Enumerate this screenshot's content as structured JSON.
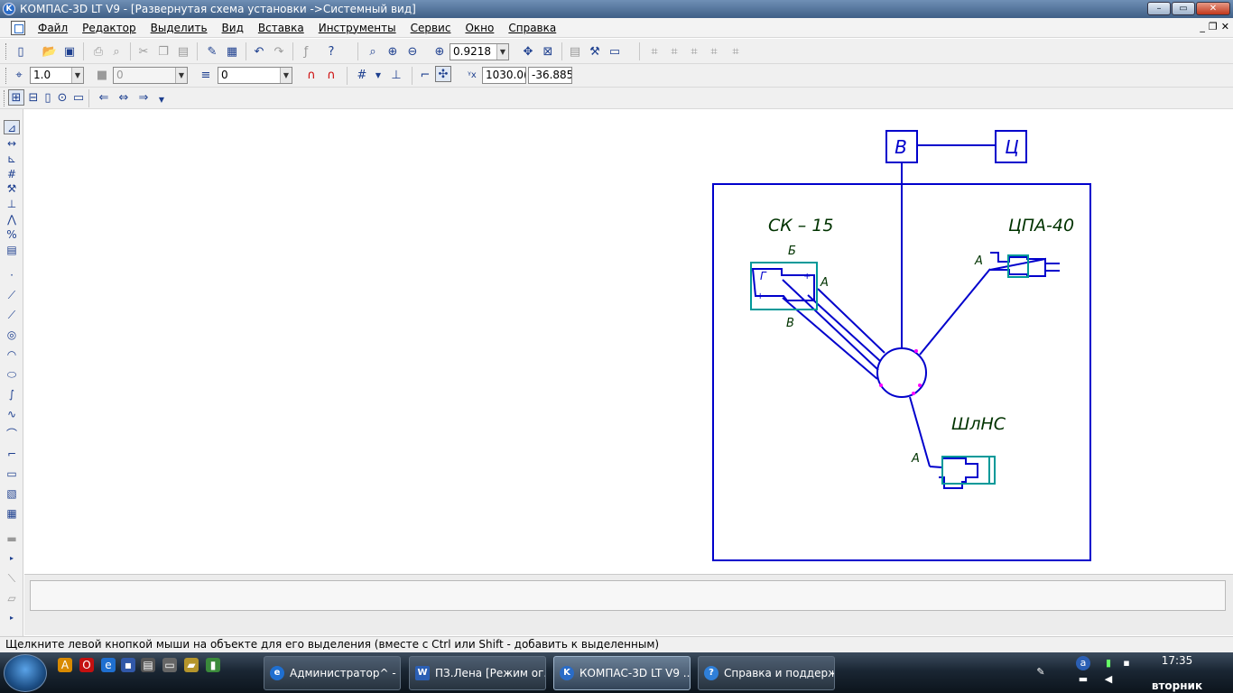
{
  "window": {
    "title": "КОМПАС-3D LT V9 - [Развернутая схема установки ->Системный вид]",
    "app_icon": "kompas-icon"
  },
  "menu": {
    "items": [
      "Файл",
      "Редактор",
      "Выделить",
      "Вид",
      "Вставка",
      "Инструменты",
      "Сервис",
      "Окно",
      "Справка"
    ]
  },
  "toolbar1": {
    "zoom_value": "0.9218"
  },
  "toolbar2": {
    "step_value": "1.0",
    "layer_value": "0",
    "style_value": "0",
    "coord_x": "1030.0(",
    "coord_y": "-36.885"
  },
  "drawing": {
    "label_v_box": "В",
    "label_ts_box": "Ц",
    "label_sk15": "СК – 15",
    "label_cpa40": "ЦПА-40",
    "label_shlns": "ШлНС",
    "port_b": "Б",
    "port_a_sk": "А",
    "port_v_sk": "В",
    "port_g_sk": "Г",
    "port_a_cpa": "А",
    "port_a_shl": "А",
    "line_color": "#0000cc",
    "equipment_color": "#009999"
  },
  "status": {
    "hint": "Щелкните левой кнопкой мыши на объекте для его выделения (вместе с Ctrl или Shift - добавить к выделенным)"
  },
  "taskbar": {
    "tasks": [
      {
        "label": "Администратор^ - ...",
        "icon": "ie-icon"
      },
      {
        "label": "ПЗ.Лена [Режим ог...",
        "icon": "word-icon"
      },
      {
        "label": "КОМПАС-3D LT V9 ...",
        "icon": "kompas-icon"
      },
      {
        "label": "Справка и поддерж...",
        "icon": "help-icon"
      }
    ],
    "time": "17:35",
    "day": "вторник"
  }
}
